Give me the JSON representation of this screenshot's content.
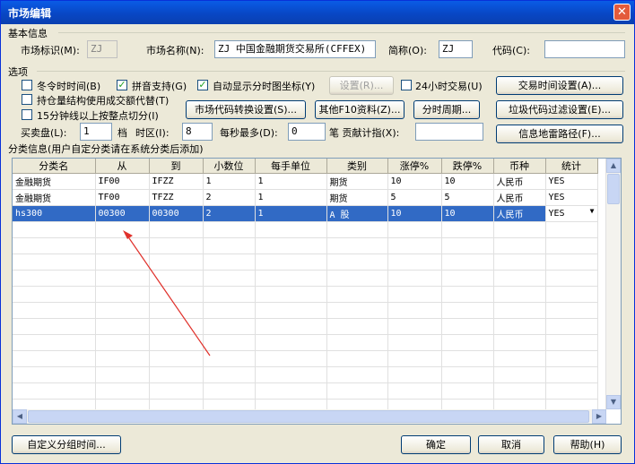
{
  "window": {
    "title": "市场编辑",
    "close_label": "✕"
  },
  "basic": {
    "group_label": "基本信息",
    "market_id_label": "市场标识(M):",
    "market_id_value": "ZJ",
    "market_name_label": "市场名称(N):",
    "market_name_value": "ZJ 中国金融期货交易所(CFFEX)",
    "short_label": "简称(O):",
    "short_value": "ZJ",
    "code_label": "代码(C):",
    "code_value": ""
  },
  "options": {
    "group_label": "选项",
    "winter_time": {
      "label": "冬令时时间(B)",
      "checked": false
    },
    "pinyin": {
      "label": "拼音支持(G)",
      "checked": true
    },
    "auto_show": {
      "label": "自动显示分时图坐标(Y)",
      "checked": true
    },
    "settings_button": "设置(R)...",
    "h24": {
      "label": "24小时交易(U)",
      "checked": false
    },
    "trade_time_button": "交易时间设置(A)...",
    "position_struct": {
      "label": "持仓量结构使用成交额代替(T)",
      "checked": false
    },
    "min15": {
      "label": "15分钟线以上按整点切分(I)",
      "checked": false
    },
    "code_convert_button": "市场代码转换设置(S)...",
    "other_f10_button": "其他F10资料(Z)...",
    "time_period_button": "分时周期...",
    "junk_filter_button": "垃圾代码过滤设置(E)...",
    "buy_sell_label": "买卖盘(L):",
    "buy_sell_value": "1",
    "level_label": "档",
    "timezone_label": "时区(I):",
    "timezone_value": "8",
    "per_second_label": "每秒最多(D):",
    "per_second_value": "0",
    "contribution_label": "笔 贡献计指(X):",
    "contribution_value": "",
    "info_mine_button": "信息地雷路径(F)..."
  },
  "category": {
    "label": "分类信息(用户自定分类请在系统分类后添加)",
    "columns": [
      "分类名",
      "从",
      "到",
      "小数位",
      "每手单位",
      "类别",
      "涨停%",
      "跌停%",
      "币种",
      "统计"
    ],
    "rows": [
      [
        "金融期货",
        "IF00",
        "IFZZ",
        "1",
        "1",
        "期货",
        "10",
        "10",
        "人民币",
        "YES"
      ],
      [
        "金融期货",
        "TF00",
        "TFZZ",
        "2",
        "1",
        "期货",
        "5",
        "5",
        "人民币",
        "YES"
      ],
      [
        "hs300",
        "00300",
        "00300",
        "2",
        "1",
        "A 股",
        "10",
        "10",
        "人民币",
        "YES"
      ]
    ],
    "selected_row": 2
  },
  "footer": {
    "custom_group_button": "自定义分组时间...",
    "ok_button": "确定",
    "cancel_button": "取消",
    "help_button": "帮助(H)"
  },
  "colors": {
    "title_bar": "#0a5ce6",
    "selection": "#316ac5",
    "annotation_arrow": "#e0302a"
  }
}
